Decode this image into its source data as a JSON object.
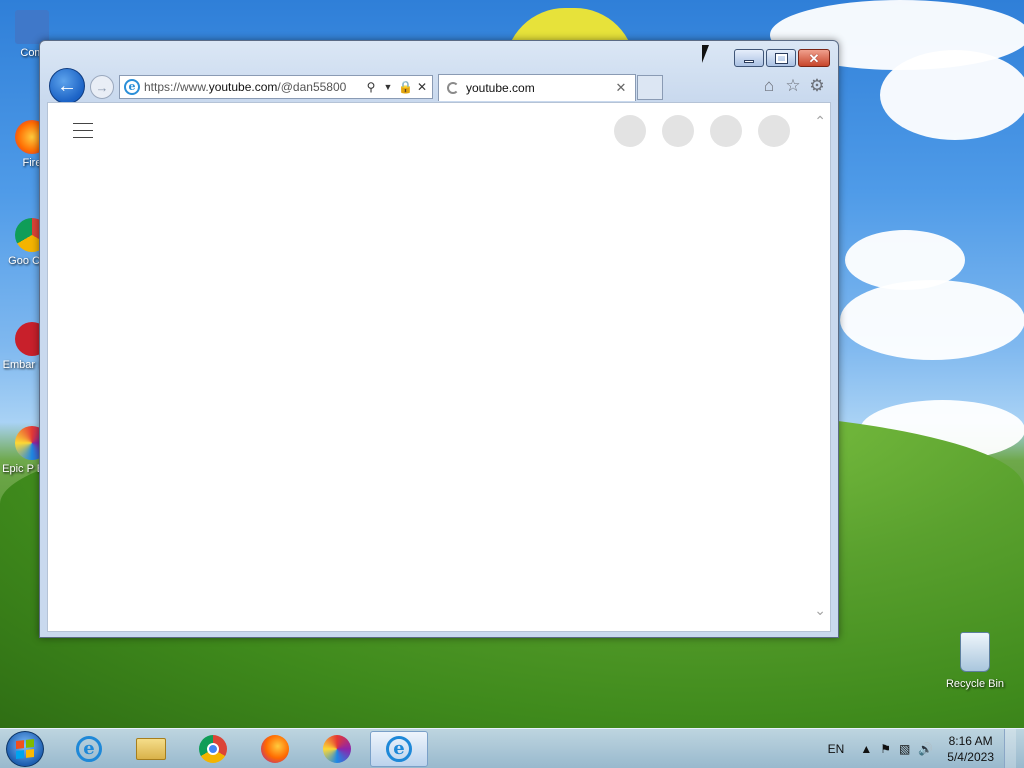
{
  "desktop": {
    "icons": [
      {
        "label": "Com"
      },
      {
        "label": "Fire"
      },
      {
        "label": "Goo Chro"
      },
      {
        "label": "Embar Dev-"
      },
      {
        "label": "Epic P Brow"
      }
    ],
    "recycle_bin": {
      "label": "Recycle Bin"
    }
  },
  "browser": {
    "address": {
      "prefix": "https://www.",
      "host": "youtube.com",
      "path": "/@dan55800"
    },
    "tab": {
      "label": "youtube.com",
      "loading": true
    },
    "window_controls": {
      "minimize": "—",
      "maximize": "□",
      "close": "✕"
    },
    "toolbar_icons": [
      "home-icon",
      "favorites-star-icon",
      "settings-gear-icon"
    ]
  },
  "page": {
    "menu_icon": "hamburger-menu-icon",
    "placeholder_count": 4
  },
  "taskbar": {
    "apps": [
      {
        "name": "internet-explorer",
        "active": false
      },
      {
        "name": "file-explorer",
        "active": false
      },
      {
        "name": "google-chrome",
        "active": false
      },
      {
        "name": "firefox",
        "active": false
      },
      {
        "name": "epic-privacy-browser",
        "active": false
      },
      {
        "name": "internet-explorer",
        "active": true
      }
    ],
    "language": "EN",
    "time": "8:16 AM",
    "date": "5/4/2023"
  }
}
